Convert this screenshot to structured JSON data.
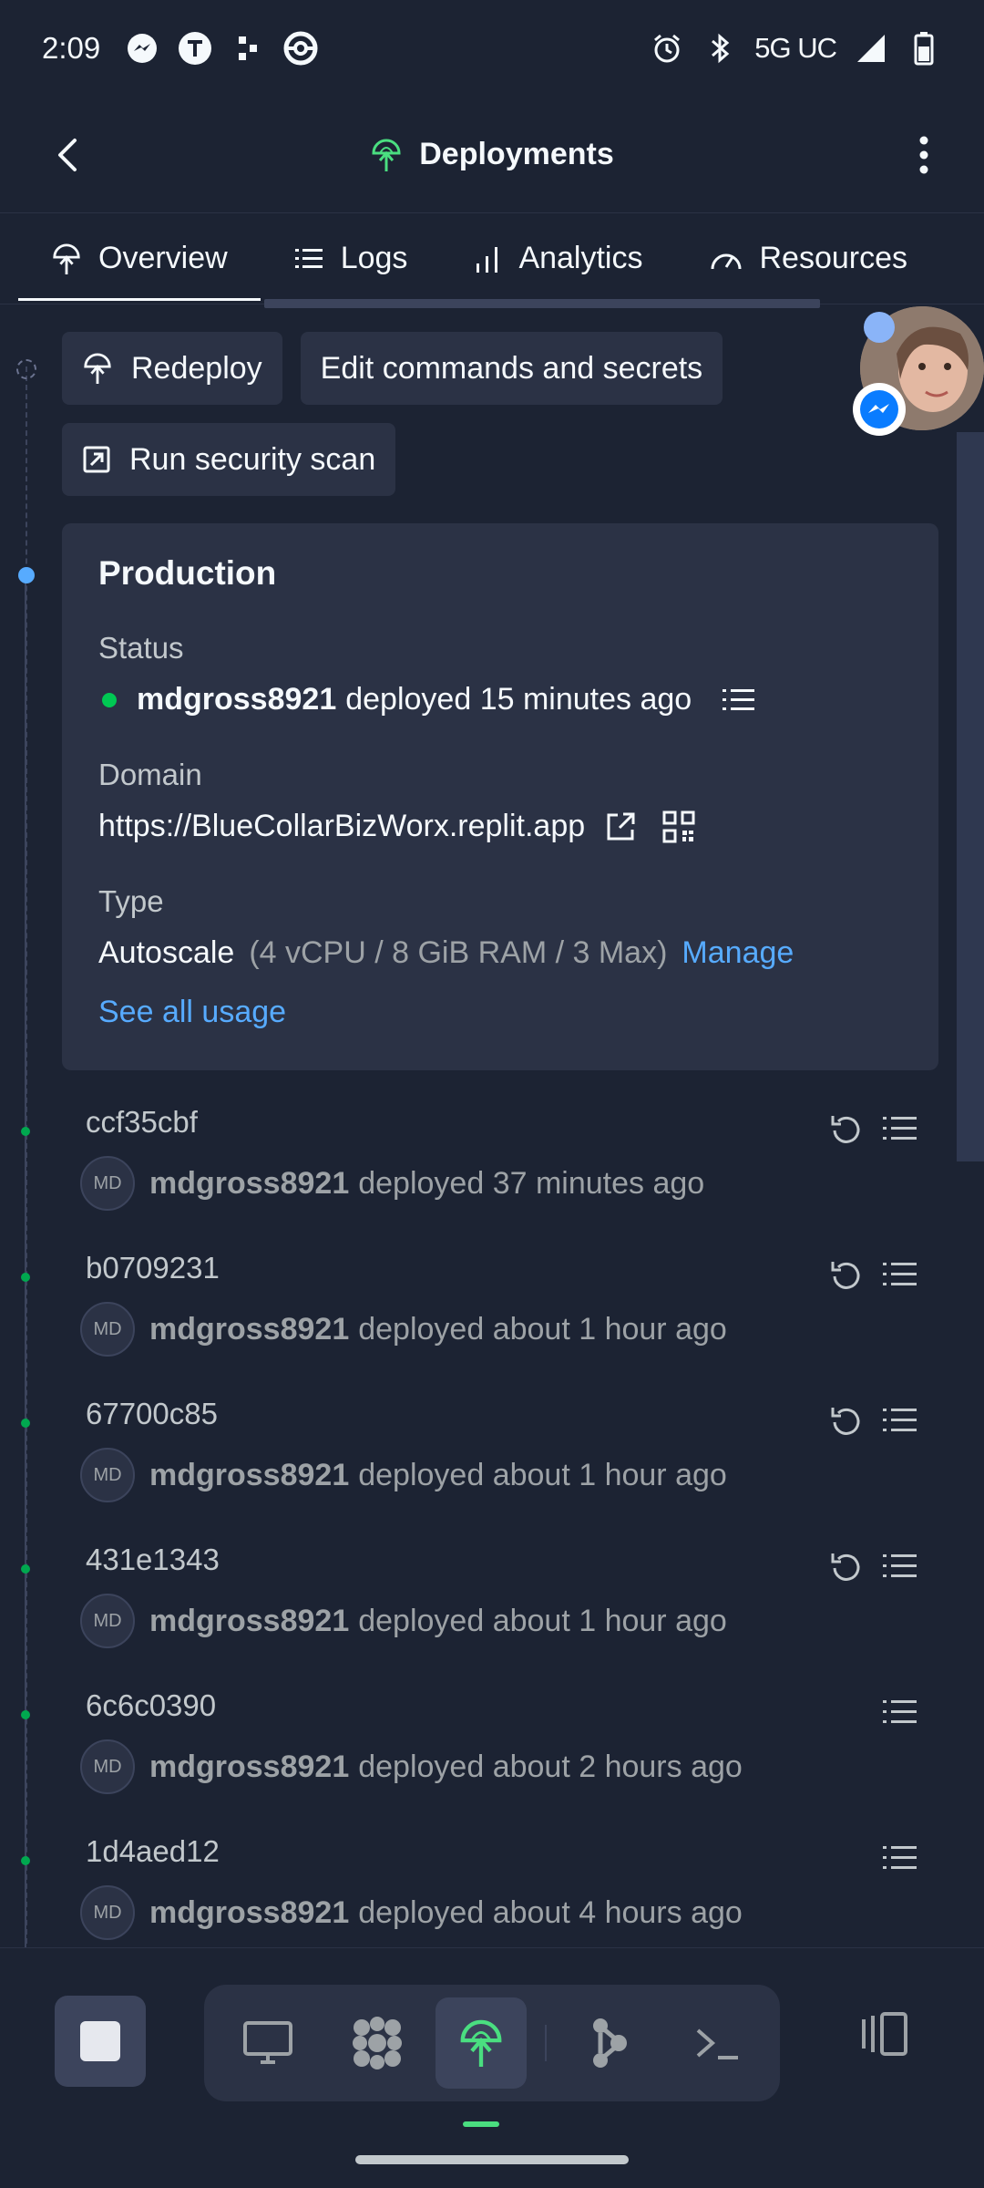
{
  "statusbar": {
    "time": "2:09",
    "network": "5G UC",
    "icons_left": [
      "messenger-icon",
      "tmobile-icon",
      "dots-icon",
      "pokeball-icon"
    ],
    "icons_right": [
      "alarm-icon",
      "bluetooth-icon",
      "signal-icon",
      "battery-icon"
    ]
  },
  "header": {
    "title": "Deployments"
  },
  "tabs": [
    {
      "label": "Overview",
      "icon": "deploy-icon",
      "active": true
    },
    {
      "label": "Logs",
      "icon": "list-icon"
    },
    {
      "label": "Analytics",
      "icon": "bar-chart-icon"
    },
    {
      "label": "Resources",
      "icon": "gauge-icon"
    }
  ],
  "actions": {
    "redeploy": "Redeploy",
    "edit": "Edit commands and secrets",
    "scan": "Run security scan"
  },
  "production": {
    "title": "Production",
    "status_label": "Status",
    "status_user": "mdgross8921",
    "status_text": "deployed 15 minutes ago",
    "domain_label": "Domain",
    "domain": "https://BlueCollarBizWorx.replit.app",
    "type_label": "Type",
    "type_value": "Autoscale",
    "type_detail": "(4 vCPU / 8 GiB RAM / 3 Max)",
    "manage": "Manage",
    "see_usage": "See all usage",
    "status_color": "#00c853"
  },
  "deployments": [
    {
      "hash": "ccf35cbf",
      "avatar": "MD",
      "user": "mdgross8921",
      "text": "deployed 37 minutes ago",
      "rollback": true
    },
    {
      "hash": "b0709231",
      "avatar": "MD",
      "user": "mdgross8921",
      "text": "deployed about 1 hour ago",
      "rollback": true
    },
    {
      "hash": "67700c85",
      "avatar": "MD",
      "user": "mdgross8921",
      "text": "deployed about 1 hour ago",
      "rollback": true
    },
    {
      "hash": "431e1343",
      "avatar": "MD",
      "user": "mdgross8921",
      "text": "deployed about 1 hour ago",
      "rollback": true
    },
    {
      "hash": "6c6c0390",
      "avatar": "MD",
      "user": "mdgross8921",
      "text": "deployed about 2 hours ago",
      "rollback": false
    },
    {
      "hash": "1d4aed12",
      "avatar": "MD",
      "user": "mdgross8921",
      "text": "deployed about 4 hours ago",
      "rollback": false
    }
  ],
  "colors": {
    "background": "#1c2333",
    "surface": "#2b3245",
    "accent_blue": "#57abff",
    "accent_green": "#4ade80"
  }
}
